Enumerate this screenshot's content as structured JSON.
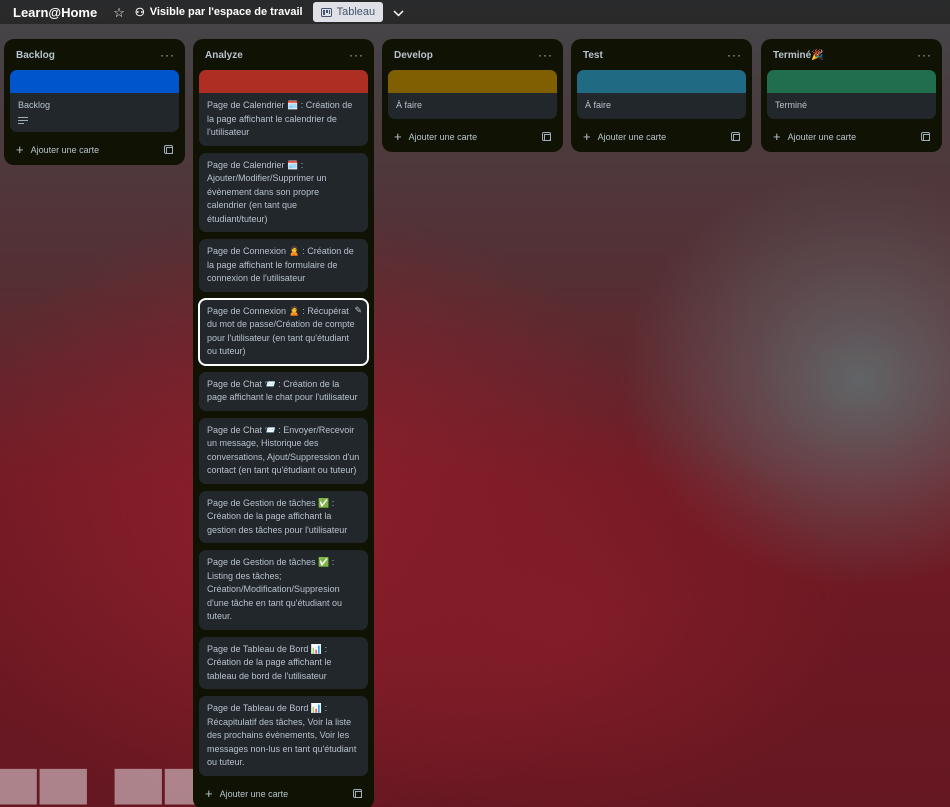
{
  "header": {
    "board_title": "Learn@Home",
    "star_icon": "star-icon",
    "visibility_label": "Visible par l'espace de travail",
    "view_label": "Tableau",
    "chevron_icon": "chevron-down-icon"
  },
  "lists": [
    {
      "title": "Backlog",
      "cards": [
        {
          "text": "Backlog",
          "cover": "#0055cc",
          "has_description": true
        }
      ],
      "add_label": "Ajouter une carte"
    },
    {
      "title": "Analyze",
      "cover": "#ae2e24",
      "cards": [
        {
          "text": "Page de Calendrier 🗓️ : Création de la page affichant le calendrier de l'utilisateur"
        },
        {
          "text": "Page de Calendrier 🗓️ : Ajouter/Modifier/Supprimer un évènement dans son propre calendrier (en tant que étudiant/tuteur)"
        },
        {
          "text": "Page de Connexion 🙎 : Création de la page affichant le formulaire de connexion de l'utilisateur"
        },
        {
          "text": "Page de Connexion 🙎 : Récupérat du mot de passe/Création de compte pour l'utilisateur (en tant qu'étudiant ou tuteur)",
          "selected": true
        },
        {
          "text": "Page de Chat 📨 : Création de la page affichant le chat pour l'utilisateur"
        },
        {
          "text": "Page de Chat 📨 : Envoyer/Recevoir un message, Historique des conversations, Ajout/Suppression d'un contact (en tant qu'étudiant ou tuteur)"
        },
        {
          "text": "Page de Gestion de tâches ✅ : Création de la page affichant la gestion des tâches pour l'utilisateur"
        },
        {
          "text": "Page de Gestion de tâches ✅ : Listing des tâches; Création/Modification/Suppresion d'une tâche en tant qu'étudiant ou tuteur."
        },
        {
          "text": "Page de Tableau de Bord 📊 : Création de la page affichant le tableau de bord de l'utilisateur"
        },
        {
          "text": "Page de Tableau de Bord 📊 : Récapitulatif des tâches, Voir la liste des prochains évènements, Voir les messages non-lus en tant qu'étudiant ou tuteur."
        }
      ],
      "add_label": "Ajouter une carte"
    },
    {
      "title": "Develop",
      "cards": [
        {
          "text": "À faire",
          "cover": "#7f5f01"
        }
      ],
      "add_label": "Ajouter une carte"
    },
    {
      "title": "Test",
      "cards": [
        {
          "text": "À faire",
          "cover": "#206a83"
        }
      ],
      "add_label": "Ajouter une carte"
    },
    {
      "title": "Terminé🎉",
      "cards": [
        {
          "text": "Terminé",
          "cover": "#216e4e"
        }
      ],
      "add_label": "Ajouter une carte"
    }
  ]
}
